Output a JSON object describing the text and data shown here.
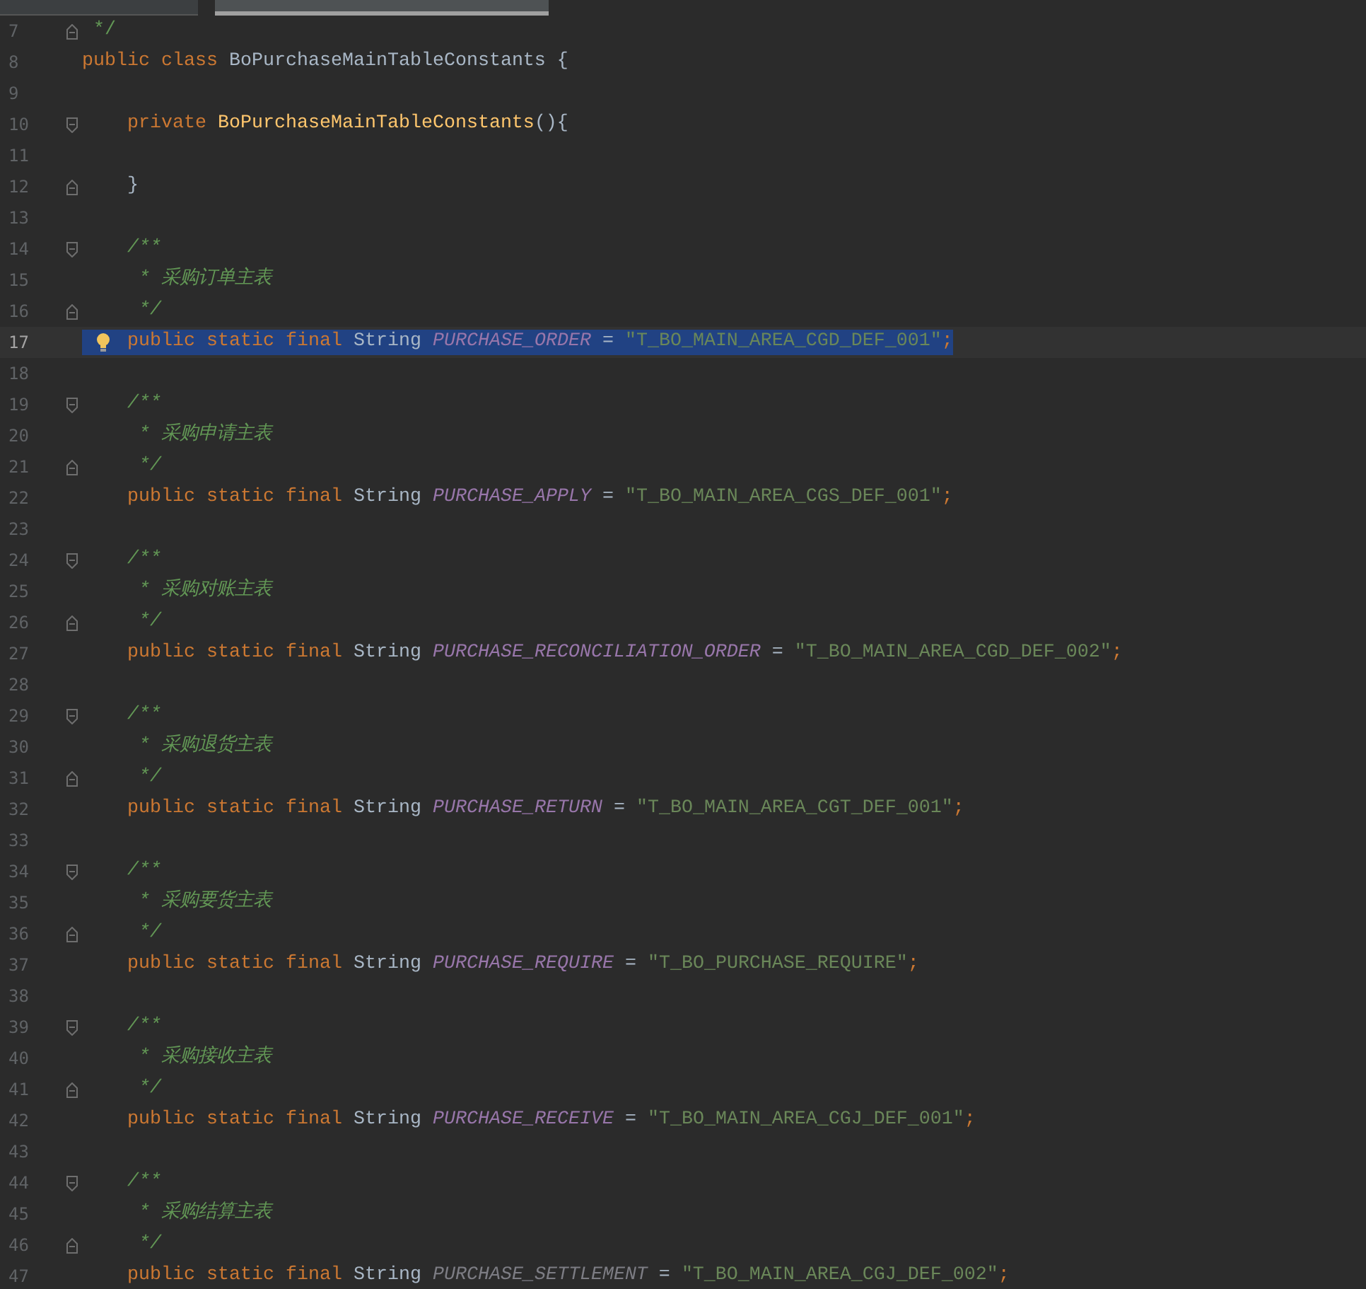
{
  "tabs": [
    {
      "selected": false
    },
    {
      "selected": true
    }
  ],
  "lines": [
    {
      "number": "7",
      "kind": "fold_end",
      "tokens": [
        {
          "kind": "comment",
          "text": " */"
        }
      ]
    },
    {
      "number": "8",
      "kind": "code",
      "tokens": [
        {
          "kind": "keyword",
          "text": "public class "
        },
        {
          "kind": "plain",
          "text": "BoPurchaseMainTableConstants {"
        }
      ]
    },
    {
      "number": "9",
      "kind": "code"
    },
    {
      "number": "10",
      "kind": "fold_start",
      "tokens": [
        {
          "kind": "keyword",
          "text": "    private "
        },
        {
          "kind": "method",
          "text": "BoPurchaseMainTableConstants"
        },
        {
          "kind": "plain",
          "text": "(){"
        }
      ]
    },
    {
      "number": "11",
      "kind": "code"
    },
    {
      "number": "12",
      "kind": "fold_end",
      "tokens": [
        {
          "kind": "plain",
          "text": "    }"
        }
      ]
    },
    {
      "number": "13",
      "kind": "code"
    },
    {
      "number": "14",
      "kind": "fold_start",
      "tokens": [
        {
          "kind": "doc",
          "text": "    /**"
        }
      ]
    },
    {
      "number": "15",
      "kind": "code",
      "tokens": [
        {
          "kind": "doc",
          "text": "     * 采购订单主表"
        }
      ]
    },
    {
      "number": "16",
      "kind": "fold_end",
      "tokens": [
        {
          "kind": "doc",
          "text": "     */"
        }
      ]
    },
    {
      "number": "17",
      "kind": "code",
      "current": true,
      "selected": true,
      "bulb": true,
      "tokens": [
        {
          "kind": "keyword",
          "text": "    public static final "
        },
        {
          "kind": "plain",
          "text": "String "
        },
        {
          "kind": "constant",
          "text": "PURCHASE_ORDER"
        },
        {
          "kind": "plain",
          "text": " = "
        },
        {
          "kind": "string",
          "text": "\"T_BO_MAIN_AREA_CGD_DEF_001\""
        },
        {
          "kind": "keyword",
          "text": ";"
        }
      ]
    },
    {
      "number": "18",
      "kind": "code"
    },
    {
      "number": "19",
      "kind": "fold_start",
      "tokens": [
        {
          "kind": "doc",
          "text": "    /**"
        }
      ]
    },
    {
      "number": "20",
      "kind": "code",
      "tokens": [
        {
          "kind": "doc",
          "text": "     * 采购申请主表"
        }
      ]
    },
    {
      "number": "21",
      "kind": "fold_end",
      "tokens": [
        {
          "kind": "doc",
          "text": "     */"
        }
      ]
    },
    {
      "number": "22",
      "kind": "code",
      "tokens": [
        {
          "kind": "keyword",
          "text": "    public static final "
        },
        {
          "kind": "plain",
          "text": "String "
        },
        {
          "kind": "constant",
          "text": "PURCHASE_APPLY"
        },
        {
          "kind": "plain",
          "text": " = "
        },
        {
          "kind": "string",
          "text": "\"T_BO_MAIN_AREA_CGS_DEF_001\""
        },
        {
          "kind": "keyword",
          "text": ";"
        }
      ]
    },
    {
      "number": "23",
      "kind": "code"
    },
    {
      "number": "24",
      "kind": "fold_start",
      "tokens": [
        {
          "kind": "doc",
          "text": "    /**"
        }
      ]
    },
    {
      "number": "25",
      "kind": "code",
      "tokens": [
        {
          "kind": "doc",
          "text": "     * 采购对账主表"
        }
      ]
    },
    {
      "number": "26",
      "kind": "fold_end",
      "tokens": [
        {
          "kind": "doc",
          "text": "     */"
        }
      ]
    },
    {
      "number": "27",
      "kind": "code",
      "tokens": [
        {
          "kind": "keyword",
          "text": "    public static final "
        },
        {
          "kind": "plain",
          "text": "String "
        },
        {
          "kind": "constant",
          "text": "PURCHASE_RECONCILIATION_ORDER"
        },
        {
          "kind": "plain",
          "text": " = "
        },
        {
          "kind": "string",
          "text": "\"T_BO_MAIN_AREA_CGD_DEF_002\""
        },
        {
          "kind": "keyword",
          "text": ";"
        }
      ]
    },
    {
      "number": "28",
      "kind": "code"
    },
    {
      "number": "29",
      "kind": "fold_start",
      "tokens": [
        {
          "kind": "doc",
          "text": "    /**"
        }
      ]
    },
    {
      "number": "30",
      "kind": "code",
      "tokens": [
        {
          "kind": "doc",
          "text": "     * 采购退货主表"
        }
      ]
    },
    {
      "number": "31",
      "kind": "fold_end",
      "tokens": [
        {
          "kind": "doc",
          "text": "     */"
        }
      ]
    },
    {
      "number": "32",
      "kind": "code",
      "tokens": [
        {
          "kind": "keyword",
          "text": "    public static final "
        },
        {
          "kind": "plain",
          "text": "String "
        },
        {
          "kind": "constant",
          "text": "PURCHASE_RETURN"
        },
        {
          "kind": "plain",
          "text": " = "
        },
        {
          "kind": "string",
          "text": "\"T_BO_MAIN_AREA_CGT_DEF_001\""
        },
        {
          "kind": "keyword",
          "text": ";"
        }
      ]
    },
    {
      "number": "33",
      "kind": "code"
    },
    {
      "number": "34",
      "kind": "fold_start",
      "tokens": [
        {
          "kind": "doc",
          "text": "    /**"
        }
      ]
    },
    {
      "number": "35",
      "kind": "code",
      "tokens": [
        {
          "kind": "doc",
          "text": "     * 采购要货主表"
        }
      ]
    },
    {
      "number": "36",
      "kind": "fold_end",
      "tokens": [
        {
          "kind": "doc",
          "text": "     */"
        }
      ]
    },
    {
      "number": "37",
      "kind": "code",
      "tokens": [
        {
          "kind": "keyword",
          "text": "    public static final "
        },
        {
          "kind": "plain",
          "text": "String "
        },
        {
          "kind": "constant",
          "text": "PURCHASE_REQUIRE"
        },
        {
          "kind": "plain",
          "text": " = "
        },
        {
          "kind": "string",
          "text": "\"T_BO_PURCHASE_REQUIRE\""
        },
        {
          "kind": "keyword",
          "text": ";"
        }
      ]
    },
    {
      "number": "38",
      "kind": "code"
    },
    {
      "number": "39",
      "kind": "fold_start",
      "tokens": [
        {
          "kind": "doc",
          "text": "    /**"
        }
      ]
    },
    {
      "number": "40",
      "kind": "code",
      "tokens": [
        {
          "kind": "doc",
          "text": "     * 采购接收主表"
        }
      ]
    },
    {
      "number": "41",
      "kind": "fold_end",
      "tokens": [
        {
          "kind": "doc",
          "text": "     */"
        }
      ]
    },
    {
      "number": "42",
      "kind": "code",
      "tokens": [
        {
          "kind": "keyword",
          "text": "    public static final "
        },
        {
          "kind": "plain",
          "text": "String "
        },
        {
          "kind": "constant",
          "text": "PURCHASE_RECEIVE"
        },
        {
          "kind": "plain",
          "text": " = "
        },
        {
          "kind": "string",
          "text": "\"T_BO_MAIN_AREA_CGJ_DEF_001\""
        },
        {
          "kind": "keyword",
          "text": ";"
        }
      ]
    },
    {
      "number": "43",
      "kind": "code"
    },
    {
      "number": "44",
      "kind": "fold_start",
      "tokens": [
        {
          "kind": "doc",
          "text": "    /**"
        }
      ]
    },
    {
      "number": "45",
      "kind": "code",
      "tokens": [
        {
          "kind": "doc",
          "text": "     * 采购结算主表"
        }
      ]
    },
    {
      "number": "46",
      "kind": "fold_end",
      "tokens": [
        {
          "kind": "doc",
          "text": "     */"
        }
      ]
    },
    {
      "number": "47",
      "kind": "code",
      "tokens": [
        {
          "kind": "keyword",
          "text": "    public static final "
        },
        {
          "kind": "plain",
          "text": "String "
        },
        {
          "kind": "unused",
          "text": "PURCHASE_SETTLEMENT"
        },
        {
          "kind": "plain",
          "text": " = "
        },
        {
          "kind": "string",
          "text": "\"T_BO_MAIN_AREA_CGJ_DEF_002\""
        },
        {
          "kind": "keyword",
          "text": ";"
        }
      ]
    }
  ]
}
